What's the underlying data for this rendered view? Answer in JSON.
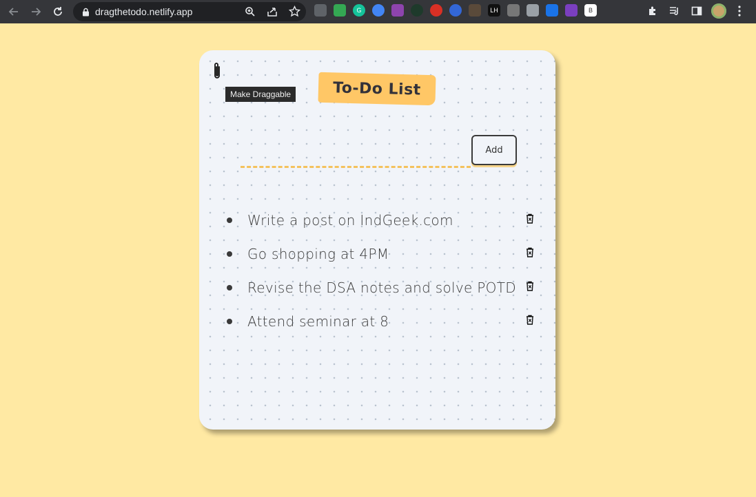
{
  "browser": {
    "url": "dragthetodo.netlify.app",
    "extensions": [
      {
        "name": "camera-icon",
        "label": "",
        "color": "#5F6368"
      },
      {
        "name": "printer-icon",
        "label": "",
        "color": "#34A853"
      },
      {
        "name": "grammarly-icon",
        "label": "G",
        "color": "#15C39A"
      },
      {
        "name": "lens-icon",
        "label": "",
        "color": "#4285F4"
      },
      {
        "name": "feather-icon",
        "label": "",
        "color": "#8E44AD"
      },
      {
        "name": "download-icon",
        "label": "",
        "color": "#1E3A2B"
      },
      {
        "name": "hand-icon",
        "label": "",
        "color": "#D93025"
      },
      {
        "name": "half-circle-icon",
        "label": "",
        "color": "#3367D6"
      },
      {
        "name": "glasses-icon",
        "label": "",
        "color": "#5A4A3A"
      },
      {
        "name": "lighthouse-icon",
        "label": "LH",
        "color": "#111111"
      },
      {
        "name": "screen-icon",
        "label": "",
        "color": "#777777"
      },
      {
        "name": "font-icon",
        "label": "",
        "color": "#9AA0A6"
      },
      {
        "name": "diamond-icon",
        "label": "",
        "color": "#1A73E8"
      },
      {
        "name": "avatar-ext-icon",
        "label": "",
        "color": "#7B3FBF"
      },
      {
        "name": "b-icon",
        "label": "B",
        "color": "#FFFFFF"
      }
    ]
  },
  "page": {
    "tooltip": "Make Draggable",
    "title": "To-Do List",
    "input_placeholder": "",
    "add_label": "Add",
    "todos": [
      {
        "text": "Write a post on IndGeek.com"
      },
      {
        "text": "Go shopping at 4PM"
      },
      {
        "text": "Revise the DSA notes and solve POTD"
      },
      {
        "text": "Attend seminar at 8"
      }
    ]
  },
  "colors": {
    "page_bg": "#FFE9A3",
    "card_bg": "#F1F4F9",
    "title_tag": "#FFC766",
    "underline": "#F4C25D"
  }
}
